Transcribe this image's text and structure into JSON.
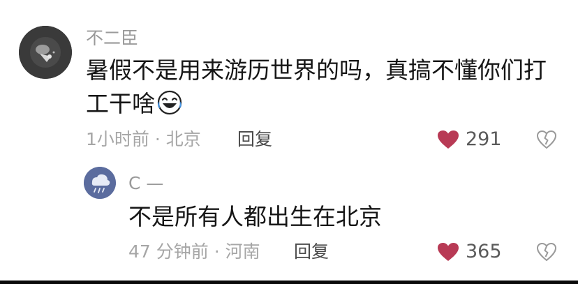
{
  "comment": {
    "username": "不二臣",
    "text_line1": "暑假不是用来游历世界的吗，真搞不懂你们打",
    "text_line2": "工干啥",
    "emoji": "laughing-crying-emoji",
    "time": "1小时前",
    "separator": "·",
    "location": "北京",
    "reply_label": "回复",
    "likes": "291"
  },
  "reply": {
    "username": "C —",
    "text": "不是所有人都出生在北京",
    "time": "47 分钟前",
    "separator": "·",
    "location": "河南",
    "reply_label": "回复",
    "likes": "365"
  },
  "colors": {
    "like_heart": "#b83a55",
    "muted_text": "#9a9a9a",
    "body_text": "#161616"
  },
  "icons": [
    "heart-icon",
    "dislike-heart-icon"
  ]
}
